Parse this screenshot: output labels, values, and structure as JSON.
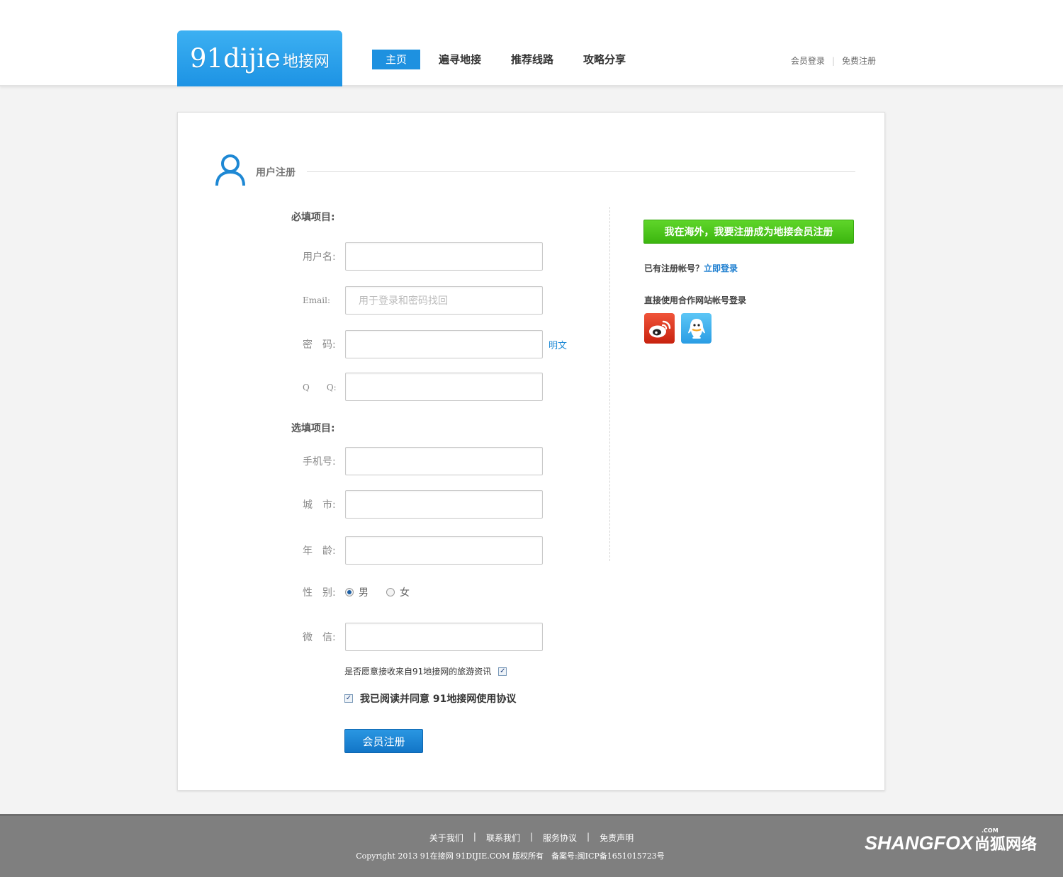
{
  "header": {
    "logo": {
      "en": "91dijie",
      "cn": "地接网"
    },
    "nav": [
      {
        "label": "主页",
        "active": true
      },
      {
        "label": "遍寻地接",
        "active": false
      },
      {
        "label": "推荐线路",
        "active": false
      },
      {
        "label": "攻略分享",
        "active": false
      }
    ],
    "top_links": {
      "login": "会员登录",
      "separator": "|",
      "register": "免费注册"
    }
  },
  "section": {
    "title": "用户注册",
    "icon": "user-icon"
  },
  "required": {
    "title": "必填项目:",
    "fields": [
      {
        "label": "用户名:",
        "value": "",
        "placeholder": ""
      },
      {
        "label": "Email:",
        "value": "",
        "placeholder": "用于登录和密码找回"
      },
      {
        "label": "密　码:",
        "value": "",
        "placeholder": "",
        "toggle": "明文"
      },
      {
        "label": "Q　　Q:",
        "value": "",
        "placeholder": ""
      }
    ]
  },
  "optional": {
    "title": "选填项目:",
    "fields": [
      {
        "label": "手机号:",
        "value": ""
      },
      {
        "label": "城　市:",
        "value": ""
      },
      {
        "label": "年　龄:",
        "value": ""
      }
    ],
    "gender": {
      "label": "性　别:",
      "options": [
        "男",
        "女"
      ],
      "selected": "男"
    },
    "wechat": {
      "label": "微　信:",
      "value": ""
    }
  },
  "newsletter": {
    "label": "是否愿意接收来自91地接网的旅游资讯",
    "checked": true
  },
  "agreement": {
    "label": "我已阅读并同意 91地接网使用协议",
    "checked": true
  },
  "submit_label": "会员注册",
  "side": {
    "overseas_button": "我在海外，我要注册成为地接会员注册",
    "has_account": "已有注册帐号？",
    "login_now": "立即登录",
    "partner_title": "直接使用合作网站帐号登录",
    "partners": [
      {
        "name": "weibo-icon",
        "color": "#d9301a"
      },
      {
        "name": "qq-icon",
        "color": "#3aabeb"
      }
    ]
  },
  "footer": {
    "links": [
      "关于我们",
      "联系我们",
      "服务协议",
      "免责声明"
    ],
    "separator": "|",
    "copyright": "Copyright 2013 91在接网 91DIJIE.COM 版权所有　备案号:闽ICP备1651015723号",
    "brand": {
      "en": "SHANGFOX",
      "cn": "尚狐网络",
      "com": ".COM"
    }
  },
  "colors": {
    "brand_blue": "#1e91e0",
    "green_button": "#4cc41c",
    "footer_bg": "#7f7f7f"
  }
}
